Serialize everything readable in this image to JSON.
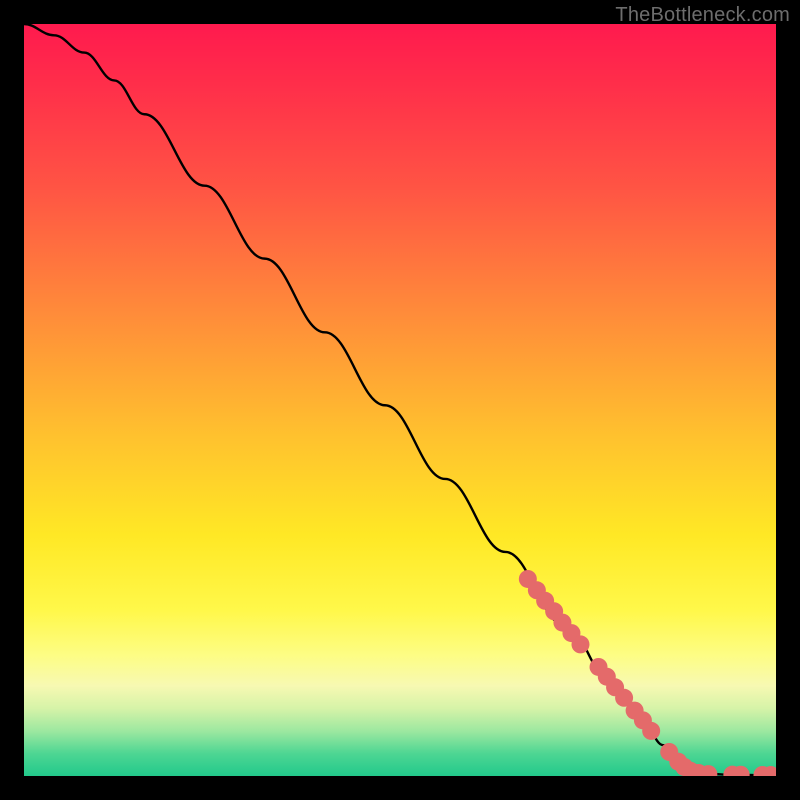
{
  "attribution": "TheBottleneck.com",
  "chart_data": {
    "type": "line",
    "title": "",
    "xlabel": "",
    "ylabel": "",
    "xlim": [
      0,
      100
    ],
    "ylim": [
      0,
      100
    ],
    "curve": [
      {
        "x": 0,
        "y": 100
      },
      {
        "x": 4,
        "y": 98.5
      },
      {
        "x": 8,
        "y": 96.2
      },
      {
        "x": 12,
        "y": 92.5
      },
      {
        "x": 16,
        "y": 88.0
      },
      {
        "x": 24,
        "y": 78.5
      },
      {
        "x": 32,
        "y": 68.8
      },
      {
        "x": 40,
        "y": 59.0
      },
      {
        "x": 48,
        "y": 49.3
      },
      {
        "x": 56,
        "y": 39.5
      },
      {
        "x": 64,
        "y": 29.8
      },
      {
        "x": 72,
        "y": 20.0
      },
      {
        "x": 78,
        "y": 12.7
      },
      {
        "x": 82,
        "y": 7.8
      },
      {
        "x": 85,
        "y": 4.1
      },
      {
        "x": 87,
        "y": 2.0
      },
      {
        "x": 89,
        "y": 0.8
      },
      {
        "x": 91,
        "y": 0.3
      },
      {
        "x": 94,
        "y": 0.15
      },
      {
        "x": 100,
        "y": 0.1
      }
    ],
    "markers": [
      {
        "x": 67.0,
        "y": 26.2
      },
      {
        "x": 68.2,
        "y": 24.7
      },
      {
        "x": 69.3,
        "y": 23.3
      },
      {
        "x": 70.5,
        "y": 21.9
      },
      {
        "x": 71.6,
        "y": 20.4
      },
      {
        "x": 72.8,
        "y": 19.0
      },
      {
        "x": 74.0,
        "y": 17.5
      },
      {
        "x": 76.4,
        "y": 14.5
      },
      {
        "x": 77.5,
        "y": 13.2
      },
      {
        "x": 78.6,
        "y": 11.8
      },
      {
        "x": 79.8,
        "y": 10.4
      },
      {
        "x": 81.2,
        "y": 8.7
      },
      {
        "x": 82.3,
        "y": 7.4
      },
      {
        "x": 83.4,
        "y": 6.0
      },
      {
        "x": 85.8,
        "y": 3.2
      },
      {
        "x": 87.0,
        "y": 1.9
      },
      {
        "x": 87.8,
        "y": 1.2
      },
      {
        "x": 88.6,
        "y": 0.7
      },
      {
        "x": 89.7,
        "y": 0.4
      },
      {
        "x": 91.0,
        "y": 0.25
      },
      {
        "x": 94.2,
        "y": 0.18
      },
      {
        "x": 95.3,
        "y": 0.17
      },
      {
        "x": 98.2,
        "y": 0.14
      },
      {
        "x": 99.3,
        "y": 0.13
      }
    ],
    "marker_color": "#e46a6a",
    "marker_radius_px": 9,
    "line_color": "#000000"
  }
}
